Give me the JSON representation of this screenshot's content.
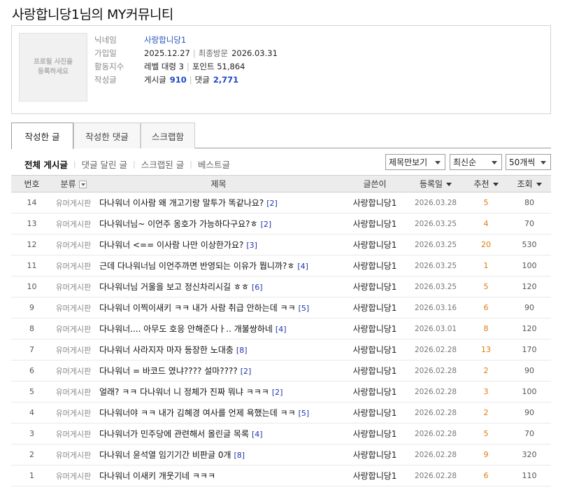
{
  "page": {
    "title": "사랑합니당1님의 MY커뮤니티"
  },
  "profile": {
    "photo_placeholder": "프로필 사진을 등록하세요",
    "nickname_label": "닉네임",
    "nickname": "사랑합니당1",
    "joined_label": "가입일",
    "joined_date": "2025.12.27",
    "last_visit_label": "최종방문",
    "last_visit_date": "2026.03.31",
    "activity_label": "활동지수",
    "level_text": "레벨 대령 3",
    "points_text": "포인트 51,864",
    "posts_label": "작성글",
    "post_count_label": "게시글",
    "post_count": "910",
    "comment_count_label": "댓글",
    "comment_count": "2,771"
  },
  "tabs": [
    {
      "label": "작성한 글",
      "active": true
    },
    {
      "label": "작성한 댓글",
      "active": false
    },
    {
      "label": "스크랩함",
      "active": false
    }
  ],
  "filters": [
    {
      "label": "전체 게시글",
      "active": true
    },
    {
      "label": "댓글 달린 글",
      "active": false
    },
    {
      "label": "스크랩된 글",
      "active": false
    },
    {
      "label": "베스트글",
      "active": false
    }
  ],
  "selects": {
    "view_mode": "제목만보기",
    "sort": "최신순",
    "page_size": "50개씩"
  },
  "table": {
    "headers": {
      "num": "번호",
      "category": "분류",
      "title": "제목",
      "author": "글쓴이",
      "date": "등록일",
      "recommend": "추천",
      "views": "조회"
    },
    "rows": [
      {
        "num": "14",
        "category": "유머게시판",
        "title": "다나워너 이사람 왜 개고기랑 말투가 똑같나요?",
        "comments": "[2]",
        "author": "사랑합니당1",
        "date": "2026.03.28",
        "recommend": "5",
        "views": "80"
      },
      {
        "num": "13",
        "category": "유머게시판",
        "title": "다나워너님~ 이언주 옹호가 가능하다구요?ㅎ",
        "comments": "[2]",
        "author": "사랑합니당1",
        "date": "2026.03.25",
        "recommend": "4",
        "views": "70"
      },
      {
        "num": "12",
        "category": "유머게시판",
        "title": "다나워너 <== 이사람 나만 이상한가요?",
        "comments": "[3]",
        "author": "사랑합니당1",
        "date": "2026.03.25",
        "recommend": "20",
        "views": "530"
      },
      {
        "num": "11",
        "category": "유머게시판",
        "title": "근데 다나워너님 이언주까면 반영되는 이유가 뭡니까?ㅎ",
        "comments": "[4]",
        "author": "사랑합니당1",
        "date": "2026.03.25",
        "recommend": "1",
        "views": "100"
      },
      {
        "num": "10",
        "category": "유머게시판",
        "title": "다나워너님 거울을 보고 정신차리시길 ㅎㅎ",
        "comments": "[6]",
        "author": "사랑합니당1",
        "date": "2026.03.25",
        "recommend": "5",
        "views": "120"
      },
      {
        "num": "9",
        "category": "유머게시판",
        "title": "다나워너 이찍이새키 ㅋㅋ 내가 사람 취급 안하는데 ㅋㅋ",
        "comments": "[5]",
        "author": "사랑합니당1",
        "date": "2026.03.16",
        "recommend": "6",
        "views": "90"
      },
      {
        "num": "8",
        "category": "유머게시판",
        "title": "다나워너.... 아무도 호응 안해준다ㅏ.. 개불쌍하네",
        "comments": "[4]",
        "author": "사랑합니당1",
        "date": "2026.03.01",
        "recommend": "8",
        "views": "120"
      },
      {
        "num": "7",
        "category": "유머게시판",
        "title": "다나워너 사라지자 마자 등장한 노대충",
        "comments": "[8]",
        "author": "사랑합니당1",
        "date": "2026.02.28",
        "recommend": "13",
        "views": "170"
      },
      {
        "num": "6",
        "category": "유머게시판",
        "title": "다나워너 = 바코드 였냐???? 설마????",
        "comments": "[2]",
        "author": "사랑합니당1",
        "date": "2026.02.28",
        "recommend": "2",
        "views": "90"
      },
      {
        "num": "5",
        "category": "유머게시판",
        "title": "얼래? ㅋㅋ 다나워너 니 정체가 진짜 뭐냐 ㅋㅋㅋ",
        "comments": "[2]",
        "author": "사랑합니당1",
        "date": "2026.02.28",
        "recommend": "3",
        "views": "100"
      },
      {
        "num": "4",
        "category": "유머게시판",
        "title": "다나워너야 ㅋㅋ 내가 김혜경 여사를 언제 욕했는데 ㅋㅋ",
        "comments": "[5]",
        "author": "사랑합니당1",
        "date": "2026.02.28",
        "recommend": "2",
        "views": "90"
      },
      {
        "num": "3",
        "category": "유머게시판",
        "title": "다나워너가 민주당에 관련해서 올린글 목록",
        "comments": "[4]",
        "author": "사랑합니당1",
        "date": "2026.02.28",
        "recommend": "5",
        "views": "70"
      },
      {
        "num": "2",
        "category": "유머게시판",
        "title": "다나워너 윤석열 임기기간 비판글 0개",
        "comments": "[8]",
        "author": "사랑합니당1",
        "date": "2026.02.28",
        "recommend": "9",
        "views": "320"
      },
      {
        "num": "1",
        "category": "유머게시판",
        "title": "다나워너 이새키 개웃기네 ㅋㅋㅋ",
        "comments": "",
        "author": "사랑합니당1",
        "date": "2026.02.28",
        "recommend": "6",
        "views": "110"
      }
    ]
  },
  "colors": {
    "accent_link": "#2a52be",
    "count_blue": "#1f47c4",
    "recommend_orange": "#e07a0c",
    "header_bg": "#ececec"
  }
}
